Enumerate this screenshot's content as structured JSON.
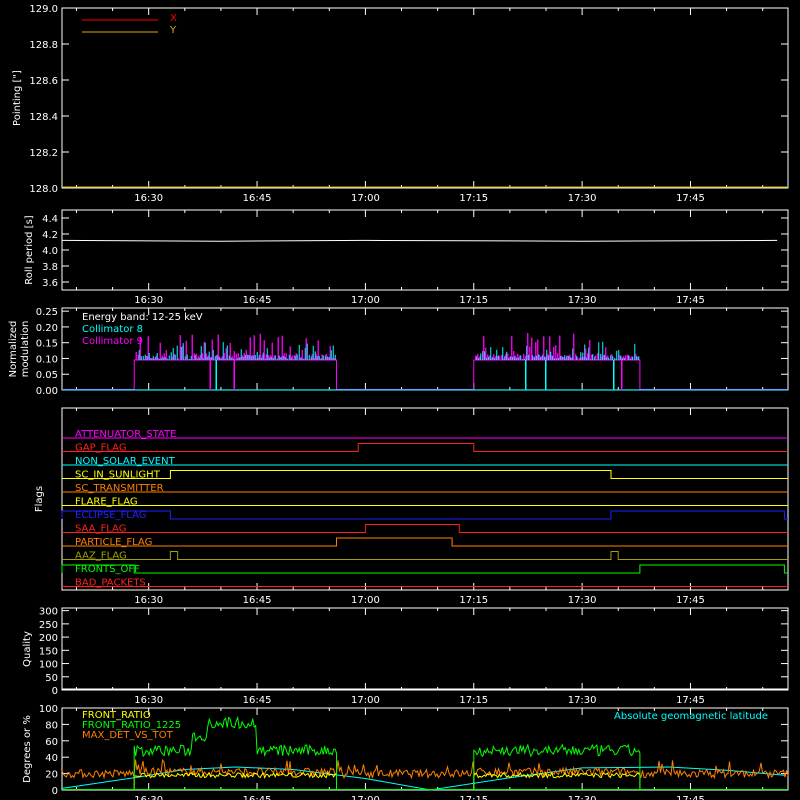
{
  "time_ticks": [
    "16:30",
    "16:45",
    "17:00",
    "17:15",
    "17:30",
    "17:45"
  ],
  "chart_data": [
    {
      "type": "line",
      "ylabel": "Pointing [\"]",
      "ylim": [
        128.0,
        129.0
      ],
      "yticks": [
        "129.0",
        "128.8",
        "128.6",
        "128.4",
        "128.2",
        "128.0"
      ],
      "legend": [
        {
          "name": "X",
          "color": "#ff0000"
        },
        {
          "name": "Y",
          "color": "#d4b000"
        }
      ],
      "series": [
        {
          "name": "X",
          "color": "#ff0000",
          "points": []
        },
        {
          "name": "Y",
          "color": "#d4b000",
          "points": []
        }
      ]
    },
    {
      "type": "line",
      "ylabel": "Roll period [s]",
      "ylim": [
        3.5,
        4.5
      ],
      "yticks": [
        "4.4",
        "4.2",
        "4.0",
        "3.8",
        "3.6"
      ],
      "series": [
        {
          "color": "#ffffff",
          "points": [
            [
              "16:18",
              4.12
            ],
            [
              "16:40",
              4.11
            ],
            [
              "17:00",
              4.12
            ],
            [
              "17:30",
              4.11
            ],
            [
              "17:57",
              4.12
            ]
          ]
        }
      ]
    },
    {
      "type": "bar",
      "ylabel": "Normalized",
      "ylabel2": "modulation",
      "ylim": [
        0,
        0.26
      ],
      "yticks": [
        "0.25",
        "0.20",
        "0.15",
        "0.10",
        "0.05",
        "0.00"
      ],
      "legend": [
        {
          "name": "Energy band: 12-25 keV",
          "color": "#ffffff"
        },
        {
          "name": "Collimator 8",
          "color": "#00ffff"
        },
        {
          "name": "Collimator 9",
          "color": "#ff00ff"
        }
      ],
      "intervals": [
        [
          "16:28",
          "16:56"
        ],
        [
          "17:15",
          "17:38"
        ]
      ],
      "baseline": 0.095
    },
    {
      "type": "line",
      "ylabel": "Flags",
      "flags": [
        {
          "name": "ATTENUATOR_STATE",
          "color": "#ff00ff",
          "steps": []
        },
        {
          "name": "GAP_FLAG",
          "color": "#ff2020",
          "steps": [
            [
              "16:59",
              "17:15"
            ]
          ]
        },
        {
          "name": "NON_SOLAR_EVENT",
          "color": "#00ffff",
          "steps": []
        },
        {
          "name": "SC_IN_SUNLIGHT",
          "color": "#ffff00",
          "steps": [
            [
              "16:33",
              "17:34"
            ]
          ]
        },
        {
          "name": "SC_TRANSMITTER",
          "color": "#ff8000",
          "steps": []
        },
        {
          "name": "FLARE_FLAG",
          "color": "#ffff00",
          "steps": []
        },
        {
          "name": "ECLIPSE_FLAG",
          "color": "#2020ff",
          "steps": [
            [
              "16:18",
              "16:33"
            ],
            [
              "17:34",
              "17:58"
            ]
          ]
        },
        {
          "name": "SAA_FLAG",
          "color": "#ff2020",
          "steps": [
            [
              "17:00",
              "17:13"
            ]
          ]
        },
        {
          "name": "PARTICLE_FLAG",
          "color": "#ff8000",
          "steps": [
            [
              "16:56",
              "17:12"
            ]
          ]
        },
        {
          "name": "AAZ_FLAG",
          "color": "#a0a000",
          "steps": [
            [
              "16:33",
              "16:34"
            ],
            [
              "17:34",
              "17:35"
            ]
          ]
        },
        {
          "name": "FRONTS_OFF",
          "color": "#00ff00",
          "steps": [
            [
              "16:18",
              "16:28"
            ],
            [
              "17:38",
              "17:58"
            ]
          ]
        },
        {
          "name": "BAD_PACKETS",
          "color": "#ff2020",
          "steps": []
        }
      ]
    },
    {
      "type": "line",
      "ylabel": "Quality",
      "ylim": [
        0,
        310
      ],
      "yticks": [
        "300",
        "250",
        "200",
        "150",
        "100",
        "50",
        "0"
      ],
      "series": []
    },
    {
      "type": "line",
      "ylabel": "Degrees or %",
      "ylim": [
        0,
        100
      ],
      "yticks": [
        "100",
        "80",
        "60",
        "40",
        "20",
        "0"
      ],
      "legend": [
        {
          "name": "FRONT_RATIO",
          "color": "#ffff00"
        },
        {
          "name": "FRONT_RATIO_1225",
          "color": "#00ff00"
        },
        {
          "name": "MAX_DET_VS_TOT",
          "color": "#ff8000"
        }
      ],
      "annotation": {
        "text": "Absolute geomagnetic latitude",
        "color": "#00ffff"
      },
      "intervals": [
        [
          "16:28",
          "16:56"
        ],
        [
          "17:15",
          "17:38"
        ]
      ],
      "series": [
        {
          "name": "Absolute geomagnetic latitude",
          "color": "#00ffff",
          "points": [
            [
              "16:18",
              2
            ],
            [
              "16:28",
              15
            ],
            [
              "16:35",
              25
            ],
            [
              "16:42",
              28
            ],
            [
              "16:50",
              25
            ],
            [
              "17:00",
              14
            ],
            [
              "17:09",
              0
            ],
            [
              "17:20",
              15
            ],
            [
              "17:30",
              27
            ],
            [
              "17:42",
              28
            ],
            [
              "17:50",
              24
            ],
            [
              "17:58",
              18
            ]
          ]
        }
      ]
    }
  ]
}
